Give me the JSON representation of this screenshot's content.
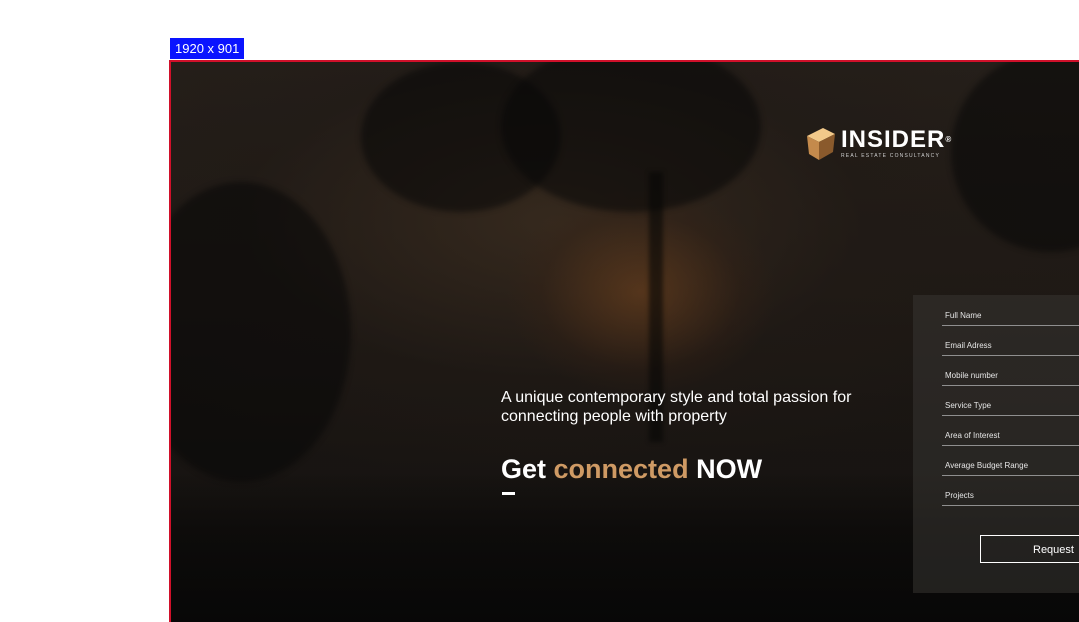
{
  "viewport_badge": "1920 x 901",
  "logo": {
    "word": "INSIDER",
    "registered": "®",
    "subtitle": "REAL ESTATE CONSULTANCY"
  },
  "hero": {
    "tagline": "A unique contemporary style and total passion for connecting people with property",
    "headline_prefix": "Get",
    "headline_accent": "connected",
    "headline_suffix": "NOW"
  },
  "form": {
    "fields": [
      {
        "label": "Full Name"
      },
      {
        "label": "Email Adress"
      },
      {
        "label": "Mobile number"
      },
      {
        "label": "Service Type"
      },
      {
        "label": "Area of Interest"
      },
      {
        "label": "Average Budget Range"
      },
      {
        "label": "Projects"
      }
    ],
    "submit_label": "Request"
  },
  "colors": {
    "accent": "#cf9a64",
    "badge": "#0a14ff",
    "frame_border": "#d0102a"
  }
}
